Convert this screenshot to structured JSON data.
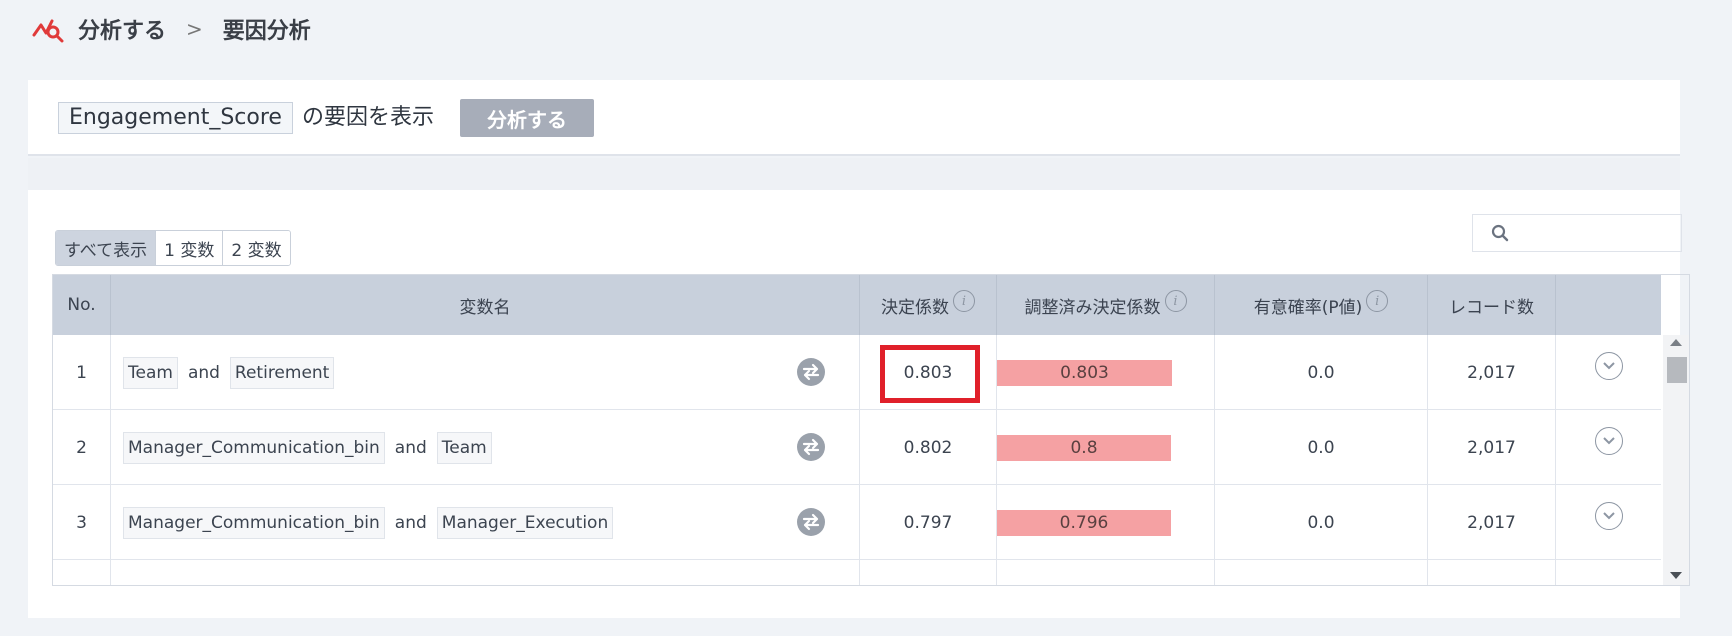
{
  "breadcrumb": {
    "analyze": "分析する",
    "sep": ">",
    "current": "要因分析"
  },
  "top": {
    "target_variable": "Engagement_Score",
    "suffix_text": "の要因を表示",
    "analyze_button": "分析する"
  },
  "filters": {
    "all": "すべて表示",
    "one": "1 変数",
    "two": "2 変数",
    "active": "all"
  },
  "search": {
    "placeholder": ""
  },
  "table": {
    "headers": {
      "no": "No.",
      "variable": "変数名",
      "r2": "決定係数",
      "adj_r2": "調整済み決定係数",
      "p_value": "有意確率(P値)",
      "records": "レコード数"
    },
    "rows": [
      {
        "no": "1",
        "var_a": "Team",
        "and": "and",
        "var_b": "Retirement",
        "r2": "0.803",
        "adj_r2": "0.803",
        "adj_r2_value": 0.803,
        "p": "0.0",
        "records": "2,017"
      },
      {
        "no": "2",
        "var_a": "Manager_Communication_bin",
        "and": "and",
        "var_b": "Team",
        "r2": "0.802",
        "adj_r2": "0.8",
        "adj_r2_value": 0.8,
        "p": "0.0",
        "records": "2,017"
      },
      {
        "no": "3",
        "var_a": "Manager_Communication_bin",
        "and": "and",
        "var_b": "Manager_Execution",
        "r2": "0.797",
        "adj_r2": "0.796",
        "adj_r2_value": 0.796,
        "p": "0.0",
        "records": "2,017"
      }
    ]
  },
  "colors": {
    "accent_logo": "#e03a3a",
    "bar": "#f5a1a3",
    "highlight": "#e0202a",
    "header_bg": "#c8d0dc"
  },
  "icons": {
    "logo": "analysis-logo-icon",
    "search": "search-icon",
    "info": "info-icon",
    "swap": "swap-icon",
    "expand": "chevron-down-icon"
  }
}
